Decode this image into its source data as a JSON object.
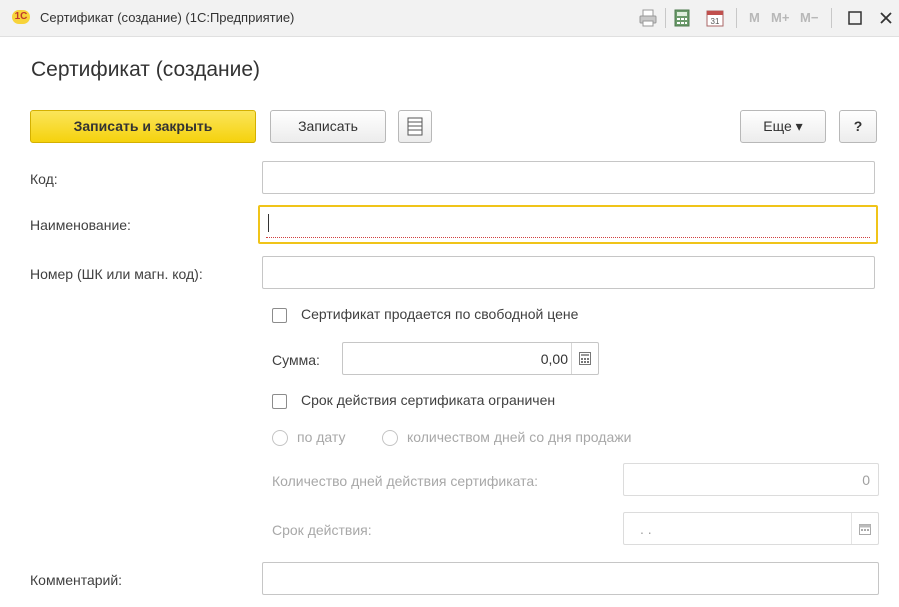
{
  "window": {
    "logo": "1С",
    "title": "Сертификат (создание) (1С:Предприятие)",
    "toolbar": {
      "m_label": "M",
      "mplus_label": "M+",
      "mminus_label": "M−",
      "calendar_day": "31"
    }
  },
  "form": {
    "title": "Сертификат (создание)",
    "buttons": {
      "save_close": "Записать и закрыть",
      "save": "Записать",
      "more": "Еще ▾",
      "help": "?"
    },
    "fields": {
      "code_label": "Код:",
      "code_value": "",
      "name_label": "Наименование:",
      "name_value": "",
      "number_label": "Номер (ШК или магн. код):",
      "number_value": "",
      "free_price_label": "Сертификат продается по свободной цене",
      "free_price_checked": false,
      "amount_label": "Сумма:",
      "amount_value": "0,00",
      "validity_limited_label": "Срок действия сертификата ограничен",
      "validity_limited_checked": false,
      "radio_by_date": "по дату",
      "radio_by_days": "количеством дней со дня продажи",
      "days_label": "Количество дней действия сертификата:",
      "days_value": "0",
      "expiry_label": "Срок действия:",
      "expiry_value": ". .",
      "comment_label": "Комментарий:",
      "comment_value": ""
    }
  },
  "colors": {
    "primary_button": "#f5d20d",
    "focus_border": "#f0c419",
    "disabled_text": "#a8a8a8"
  }
}
